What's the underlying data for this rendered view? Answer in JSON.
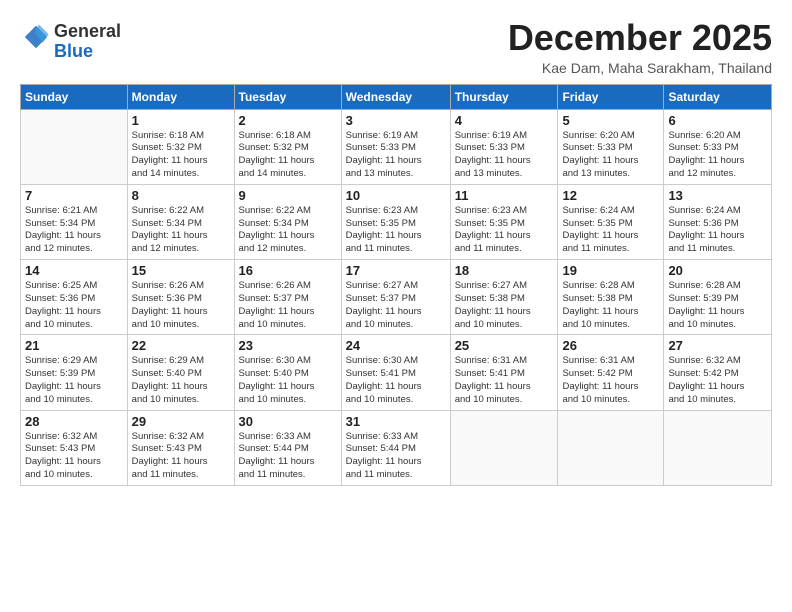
{
  "logo": {
    "general": "General",
    "blue": "Blue"
  },
  "title": "December 2025",
  "subtitle": "Kae Dam, Maha Sarakham, Thailand",
  "headers": [
    "Sunday",
    "Monday",
    "Tuesday",
    "Wednesday",
    "Thursday",
    "Friday",
    "Saturday"
  ],
  "weeks": [
    [
      {
        "day": "",
        "info": ""
      },
      {
        "day": "1",
        "info": "Sunrise: 6:18 AM\nSunset: 5:32 PM\nDaylight: 11 hours\nand 14 minutes."
      },
      {
        "day": "2",
        "info": "Sunrise: 6:18 AM\nSunset: 5:32 PM\nDaylight: 11 hours\nand 14 minutes."
      },
      {
        "day": "3",
        "info": "Sunrise: 6:19 AM\nSunset: 5:33 PM\nDaylight: 11 hours\nand 13 minutes."
      },
      {
        "day": "4",
        "info": "Sunrise: 6:19 AM\nSunset: 5:33 PM\nDaylight: 11 hours\nand 13 minutes."
      },
      {
        "day": "5",
        "info": "Sunrise: 6:20 AM\nSunset: 5:33 PM\nDaylight: 11 hours\nand 13 minutes."
      },
      {
        "day": "6",
        "info": "Sunrise: 6:20 AM\nSunset: 5:33 PM\nDaylight: 11 hours\nand 12 minutes."
      }
    ],
    [
      {
        "day": "7",
        "info": "Sunrise: 6:21 AM\nSunset: 5:34 PM\nDaylight: 11 hours\nand 12 minutes."
      },
      {
        "day": "8",
        "info": "Sunrise: 6:22 AM\nSunset: 5:34 PM\nDaylight: 11 hours\nand 12 minutes."
      },
      {
        "day": "9",
        "info": "Sunrise: 6:22 AM\nSunset: 5:34 PM\nDaylight: 11 hours\nand 12 minutes."
      },
      {
        "day": "10",
        "info": "Sunrise: 6:23 AM\nSunset: 5:35 PM\nDaylight: 11 hours\nand 11 minutes."
      },
      {
        "day": "11",
        "info": "Sunrise: 6:23 AM\nSunset: 5:35 PM\nDaylight: 11 hours\nand 11 minutes."
      },
      {
        "day": "12",
        "info": "Sunrise: 6:24 AM\nSunset: 5:35 PM\nDaylight: 11 hours\nand 11 minutes."
      },
      {
        "day": "13",
        "info": "Sunrise: 6:24 AM\nSunset: 5:36 PM\nDaylight: 11 hours\nand 11 minutes."
      }
    ],
    [
      {
        "day": "14",
        "info": "Sunrise: 6:25 AM\nSunset: 5:36 PM\nDaylight: 11 hours\nand 10 minutes."
      },
      {
        "day": "15",
        "info": "Sunrise: 6:26 AM\nSunset: 5:36 PM\nDaylight: 11 hours\nand 10 minutes."
      },
      {
        "day": "16",
        "info": "Sunrise: 6:26 AM\nSunset: 5:37 PM\nDaylight: 11 hours\nand 10 minutes."
      },
      {
        "day": "17",
        "info": "Sunrise: 6:27 AM\nSunset: 5:37 PM\nDaylight: 11 hours\nand 10 minutes."
      },
      {
        "day": "18",
        "info": "Sunrise: 6:27 AM\nSunset: 5:38 PM\nDaylight: 11 hours\nand 10 minutes."
      },
      {
        "day": "19",
        "info": "Sunrise: 6:28 AM\nSunset: 5:38 PM\nDaylight: 11 hours\nand 10 minutes."
      },
      {
        "day": "20",
        "info": "Sunrise: 6:28 AM\nSunset: 5:39 PM\nDaylight: 11 hours\nand 10 minutes."
      }
    ],
    [
      {
        "day": "21",
        "info": "Sunrise: 6:29 AM\nSunset: 5:39 PM\nDaylight: 11 hours\nand 10 minutes."
      },
      {
        "day": "22",
        "info": "Sunrise: 6:29 AM\nSunset: 5:40 PM\nDaylight: 11 hours\nand 10 minutes."
      },
      {
        "day": "23",
        "info": "Sunrise: 6:30 AM\nSunset: 5:40 PM\nDaylight: 11 hours\nand 10 minutes."
      },
      {
        "day": "24",
        "info": "Sunrise: 6:30 AM\nSunset: 5:41 PM\nDaylight: 11 hours\nand 10 minutes."
      },
      {
        "day": "25",
        "info": "Sunrise: 6:31 AM\nSunset: 5:41 PM\nDaylight: 11 hours\nand 10 minutes."
      },
      {
        "day": "26",
        "info": "Sunrise: 6:31 AM\nSunset: 5:42 PM\nDaylight: 11 hours\nand 10 minutes."
      },
      {
        "day": "27",
        "info": "Sunrise: 6:32 AM\nSunset: 5:42 PM\nDaylight: 11 hours\nand 10 minutes."
      }
    ],
    [
      {
        "day": "28",
        "info": "Sunrise: 6:32 AM\nSunset: 5:43 PM\nDaylight: 11 hours\nand 10 minutes."
      },
      {
        "day": "29",
        "info": "Sunrise: 6:32 AM\nSunset: 5:43 PM\nDaylight: 11 hours\nand 11 minutes."
      },
      {
        "day": "30",
        "info": "Sunrise: 6:33 AM\nSunset: 5:44 PM\nDaylight: 11 hours\nand 11 minutes."
      },
      {
        "day": "31",
        "info": "Sunrise: 6:33 AM\nSunset: 5:44 PM\nDaylight: 11 hours\nand 11 minutes."
      },
      {
        "day": "",
        "info": ""
      },
      {
        "day": "",
        "info": ""
      },
      {
        "day": "",
        "info": ""
      }
    ]
  ]
}
